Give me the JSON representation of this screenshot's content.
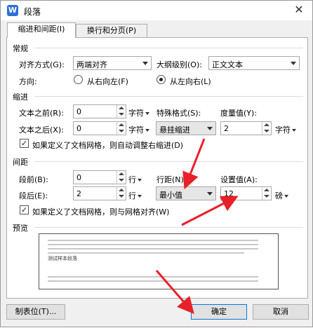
{
  "window": {
    "icon_letter": "W",
    "title": "段落",
    "close_glyph": "✕"
  },
  "tabs": [
    {
      "label": "缩进和间距(I)",
      "active": true
    },
    {
      "label": "换行和分页(P)",
      "active": false
    }
  ],
  "general": {
    "section_title": "常规",
    "alignment_label": "对齐方式(G):",
    "alignment_value": "两端对齐",
    "outline_label": "大纲级别(O):",
    "outline_value": "正文文本",
    "direction_label": "方向:",
    "rtl_label": "从右向左(F)",
    "ltr_label": "从左向右(L)",
    "direction_selected": "ltr"
  },
  "indent": {
    "section_title": "缩进",
    "before_label": "文本之前(R):",
    "before_value": "0",
    "before_unit": "字符",
    "after_label": "文本之后(X):",
    "after_value": "0",
    "after_unit": "字符",
    "special_label": "特殊格式(S):",
    "special_value": "悬挂缩进",
    "measure_label": "度量值(Y):",
    "measure_value": "2",
    "measure_unit": "字符",
    "auto_adjust_label": "如果定义了文档网格，则自动调整右缩进(D)",
    "auto_adjust_checked": true
  },
  "spacing": {
    "section_title": "间距",
    "before_label": "段前(B):",
    "before_value": "0",
    "before_unit": "行",
    "after_label": "段后(E):",
    "after_value": "2",
    "after_unit": "行",
    "line_label": "行距(N):",
    "line_value": "最小值",
    "setting_label": "设置值(A):",
    "setting_value": "12",
    "setting_unit": "磅",
    "grid_align_label": "如果定义了文档网格，则与网格对齐(W)",
    "grid_align_checked": true
  },
  "preview": {
    "section_title": "预览",
    "sample_text": "测试样本段落"
  },
  "buttons": {
    "tabs_label": "制表位(T)...",
    "ok_label": "确定",
    "cancel_label": "取消"
  },
  "accent_colors": {
    "annotation_arrow": "#e8202a",
    "primary_border": "#0078d7"
  }
}
